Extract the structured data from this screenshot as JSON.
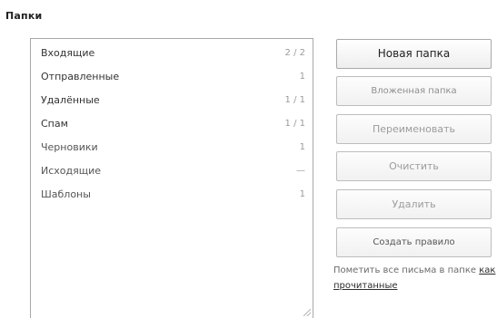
{
  "section": {
    "title": "Папки"
  },
  "folders": [
    {
      "name": "Входящие",
      "count": "2 / 2"
    },
    {
      "name": "Отправленные",
      "count": "1"
    },
    {
      "name": "Удалённые",
      "count": "1 / 1"
    },
    {
      "name": "Спам",
      "count": "1 / 1"
    },
    {
      "name": "Черновики",
      "count": "1"
    },
    {
      "name": "Исходящие",
      "count": "—"
    },
    {
      "name": "Шаблоны",
      "count": "1"
    }
  ],
  "buttons": {
    "new_folder": "Новая папка",
    "nested_folder": "Вложенная папка",
    "rename": "Переименовать",
    "clear": "Очистить",
    "delete": "Удалить",
    "create_rule": "Создать правило"
  },
  "hint": {
    "text": "Пометить все письма в папке",
    "link": "как прочитанные"
  }
}
